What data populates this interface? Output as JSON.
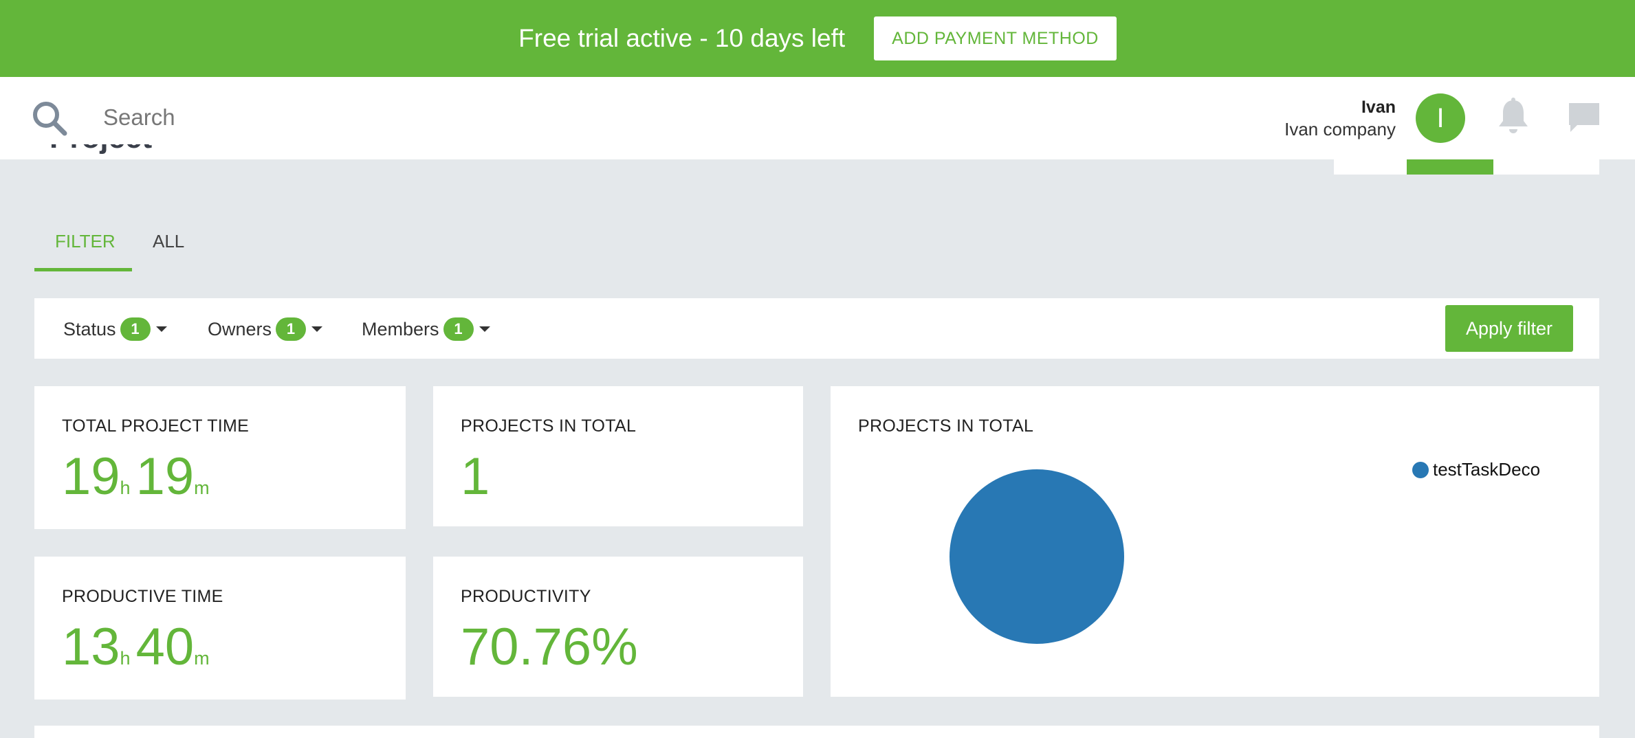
{
  "banner": {
    "text": "Free trial active - 10 days left",
    "button_label": "ADD PAYMENT METHOD"
  },
  "header": {
    "search_placeholder": "Search",
    "user_name": "Ivan",
    "company": "Ivan company",
    "avatar_initial": "I",
    "icons": [
      "search-icon",
      "bell-icon",
      "chat-icon"
    ]
  },
  "page": {
    "title": "Projects"
  },
  "tabs": [
    {
      "label": "FILTER",
      "active": true
    },
    {
      "label": "ALL",
      "active": false
    }
  ],
  "filters": {
    "items": [
      {
        "label": "Status",
        "count": "1"
      },
      {
        "label": "Owners",
        "count": "1"
      },
      {
        "label": "Members",
        "count": "1"
      }
    ],
    "apply_label": "Apply filter"
  },
  "stats": {
    "total_project_time": {
      "title": "TOTAL PROJECT TIME",
      "hours": "19",
      "h_unit": "h",
      "minutes": "19",
      "m_unit": "m"
    },
    "projects_in_total": {
      "title": "PROJECTS IN TOTAL",
      "value": "1"
    },
    "productive_time": {
      "title": "PRODUCTIVE TIME",
      "hours": "13",
      "h_unit": "h",
      "minutes": "40",
      "m_unit": "m"
    },
    "productivity": {
      "title": "PRODUCTIVITY",
      "value": "70.76%"
    }
  },
  "pie_card": {
    "title": "PROJECTS IN TOTAL"
  },
  "chart_data": {
    "type": "pie",
    "labels": [
      "testTaskDeco"
    ],
    "values": [
      1
    ],
    "colors": [
      "#2878b4"
    ],
    "title": "PROJECTS IN TOTAL",
    "legend": "top-right"
  },
  "colors": {
    "accent": "#63b63a",
    "background": "#e4e8eb",
    "pie": "#2878b4"
  }
}
